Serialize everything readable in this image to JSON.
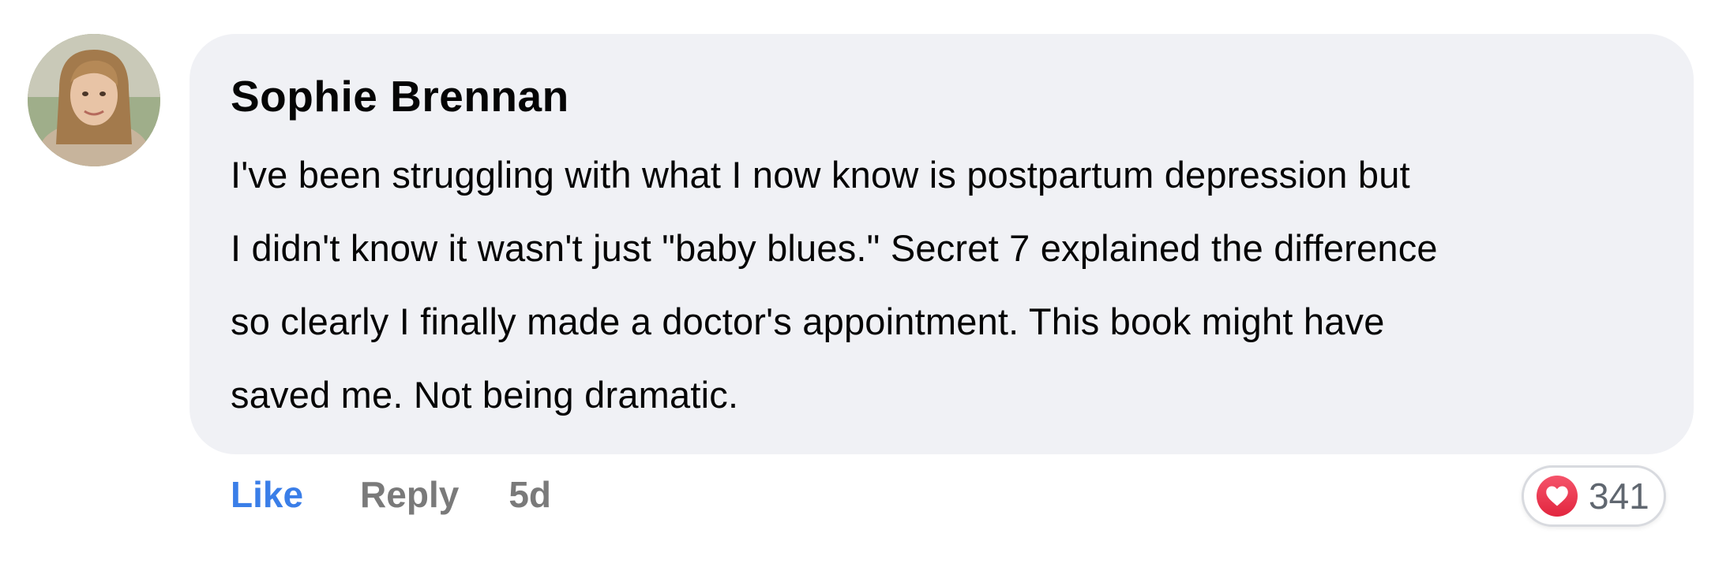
{
  "comment": {
    "author": "Sophie Brennan",
    "text_lines": [
      "I've been struggling with what I now know is postpartum depression but",
      "I didn't know it wasn't just \"baby blues.\" Secret 7 explained the difference",
      "so clearly I finally made a doctor's appointment. This book might have",
      "saved me. Not being dramatic."
    ],
    "actions": {
      "like_label": "Like",
      "reply_label": "Reply",
      "timestamp": "5d"
    },
    "reactions": {
      "icon": "heart-icon",
      "count": "341"
    }
  },
  "colors": {
    "bubble": "#f0f1f5",
    "like_blue": "#3a7ee8",
    "muted": "#7a7a7a",
    "heart_red": "#e2263f"
  }
}
